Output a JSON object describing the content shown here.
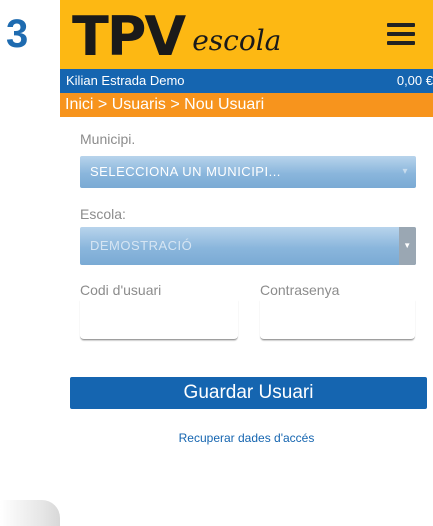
{
  "step": "3",
  "header": {
    "logo_main": "TPV",
    "logo_sub": "escola",
    "menu_icon": "hamburger-menu-icon"
  },
  "userbar": {
    "user_name": "Kilian Estrada Demo",
    "balance": "0,00 €"
  },
  "breadcrumb": "Inici > Usuaris > Nou Usuari",
  "form": {
    "municipi_label": "Municipi.",
    "municipi_value": "SELECCIONA UN MUNICIPI...",
    "escola_label": "Escola:",
    "escola_value": "DEMOSTRACIÓ",
    "codi_label": "Codi d'usuari",
    "codi_value": "",
    "pass_label": "Contrasenya",
    "pass_value": ""
  },
  "save_label": "Guardar Usuari",
  "recover_label": "Recuperar dades d'accés",
  "colors": {
    "header_yellow": "#fdb813",
    "userbar_blue": "#1565b0",
    "breadcrumb_orange": "#f7941d",
    "step_blue": "#1e6bb0"
  }
}
